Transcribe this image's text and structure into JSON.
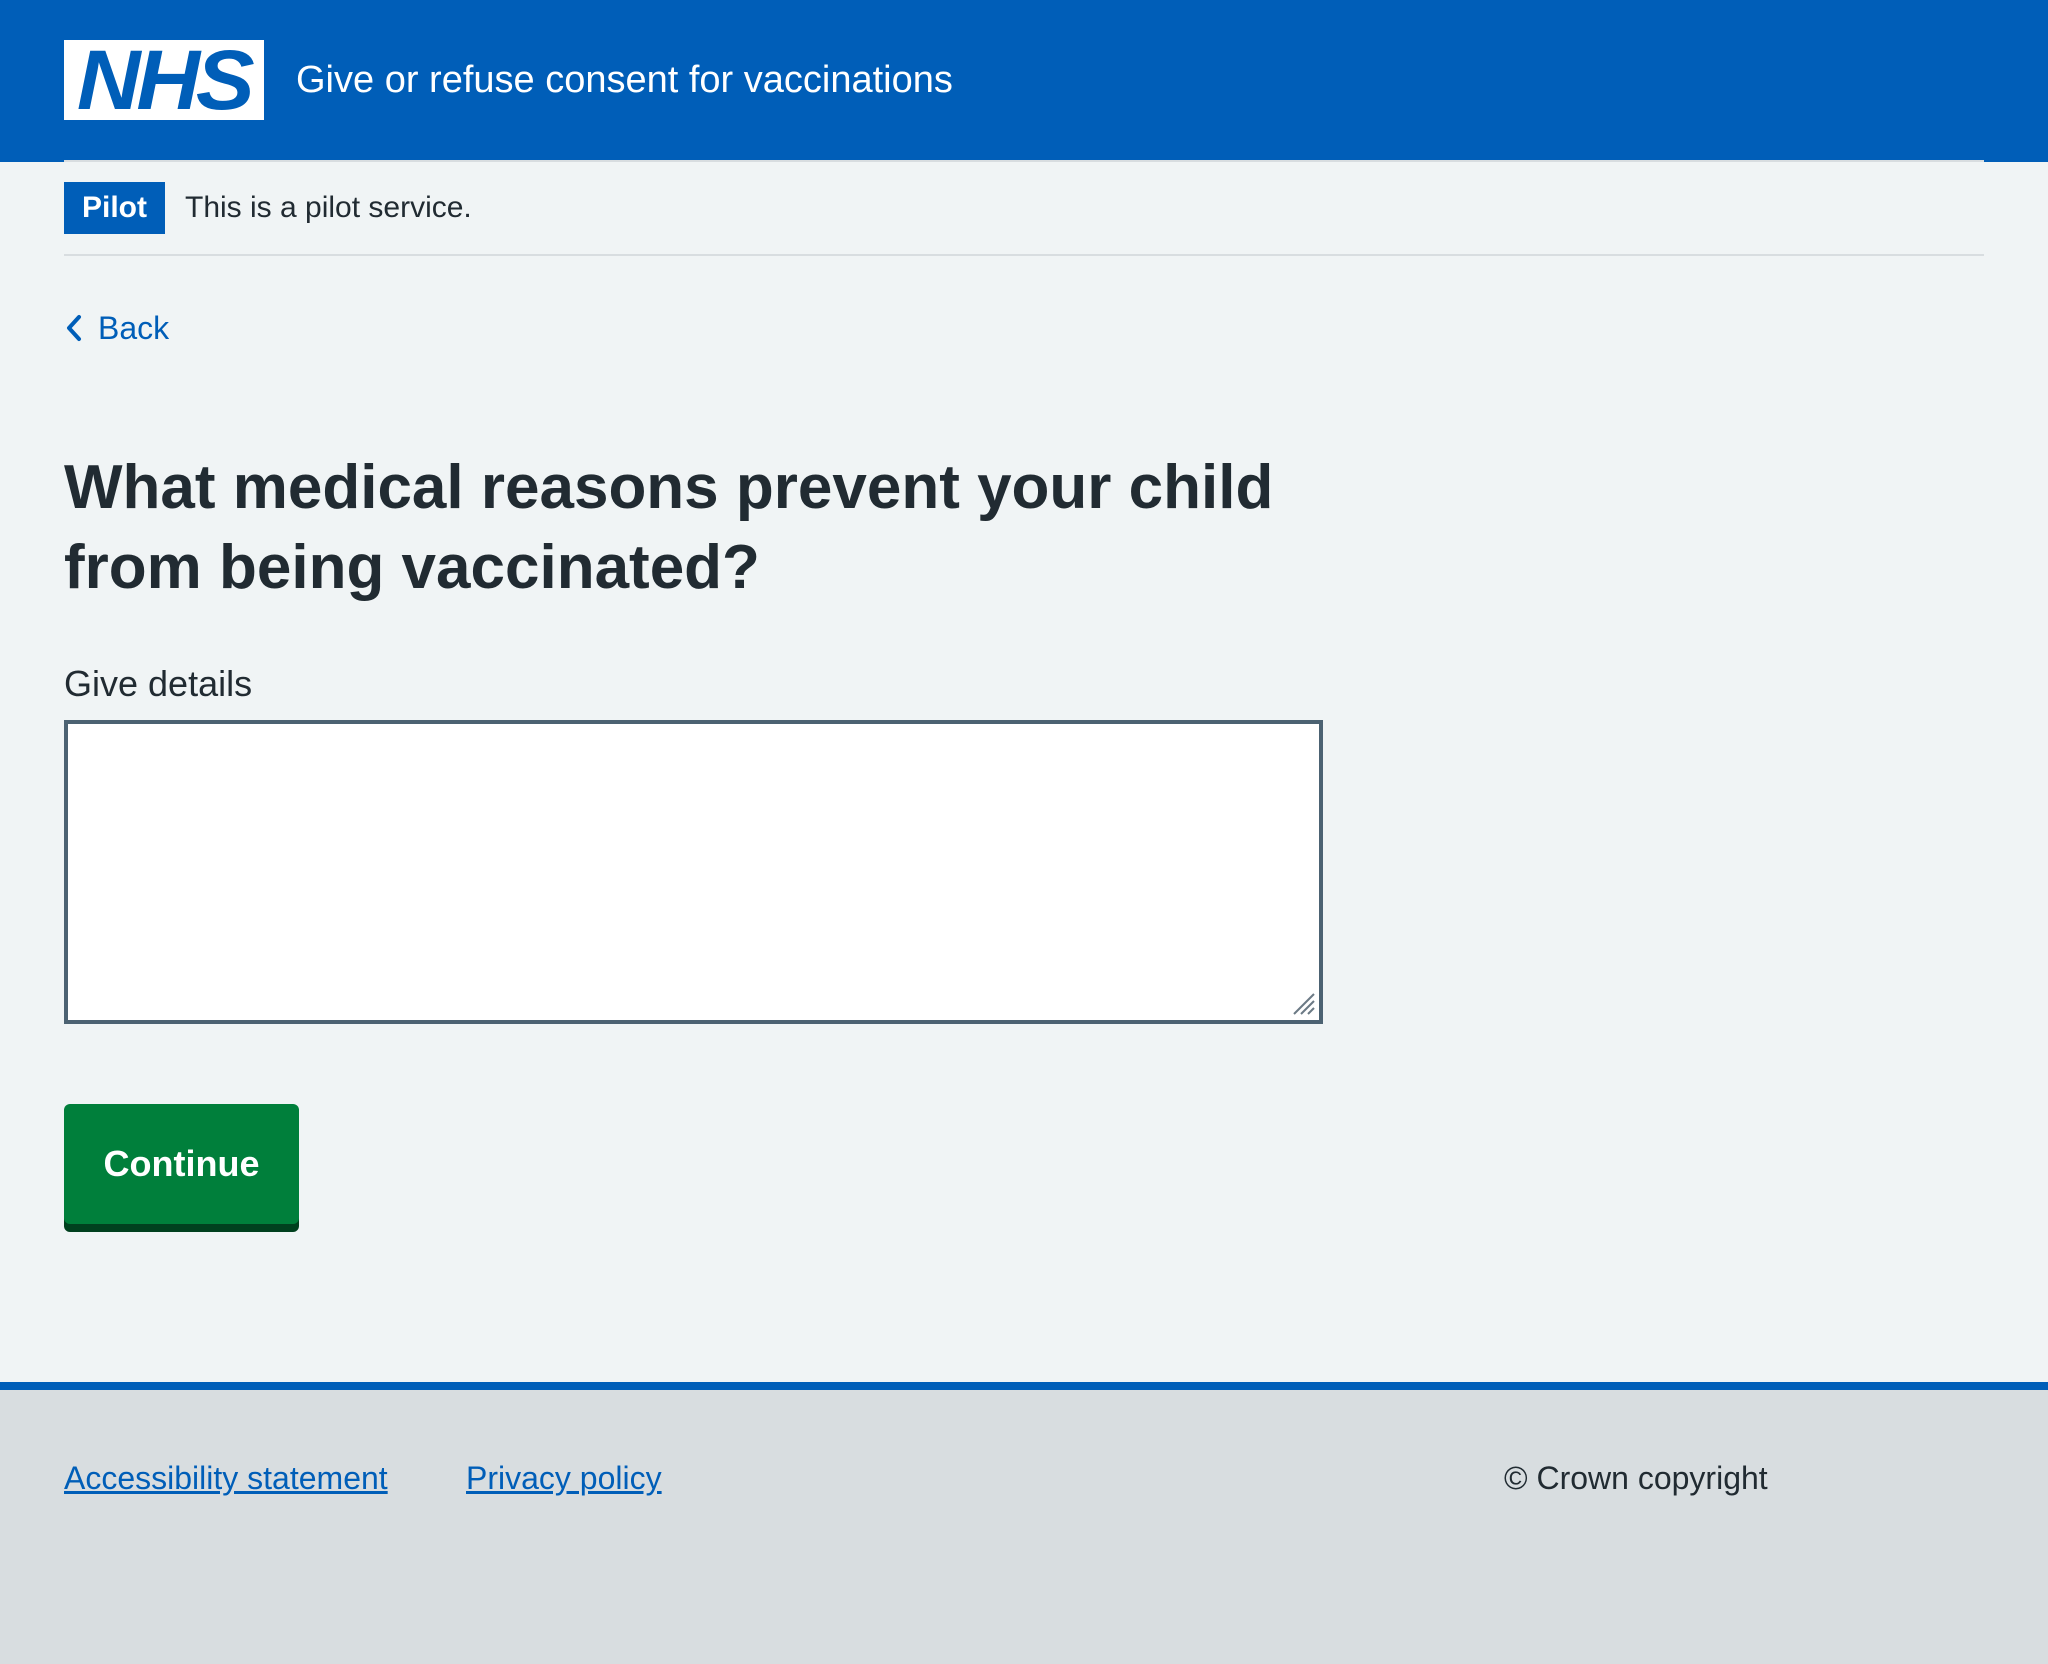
{
  "header": {
    "logo_text": "NHS",
    "service_name": "Give or refuse consent for vaccinations"
  },
  "phase_banner": {
    "tag": "Pilot",
    "text": "This is a pilot service."
  },
  "nav": {
    "back_label": "Back"
  },
  "form": {
    "question": "What medical reasons prevent your child from being vaccinated?",
    "field_label": "Give details",
    "field_value": "",
    "submit_label": "Continue"
  },
  "footer": {
    "links": [
      "Accessibility statement",
      "Privacy policy"
    ],
    "copyright": "© Crown copyright"
  },
  "colors": {
    "nhs_blue": "#005eb8",
    "page_background": "#f0f4f5",
    "button_green": "#007f3b",
    "text": "#212b32",
    "footer_background": "#d8dde0"
  }
}
